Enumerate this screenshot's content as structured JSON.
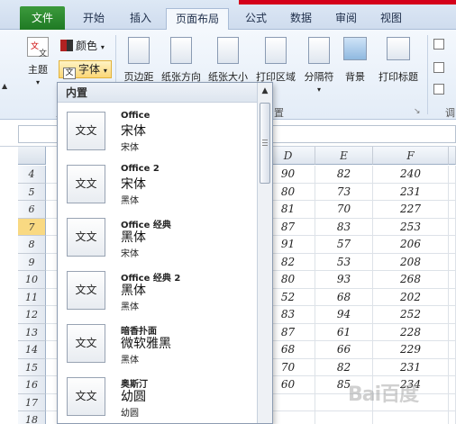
{
  "ribbon_tabs": [
    "文件",
    "开始",
    "插入",
    "页面布局",
    "公式",
    "数据",
    "审阅",
    "视图"
  ],
  "active_tab": "页面布局",
  "ribbon": {
    "theme_label": "主题",
    "colors_label": "颜色",
    "fonts_label": "字体",
    "margins_label": "页边距",
    "orientation_label": "纸张方向",
    "size_label": "纸张大小",
    "print_area_label": "打印区域",
    "breaks_label": "分隔符",
    "background_label": "背景",
    "print_titles_label": "打印标题",
    "page_setup_group": "置",
    "theme_group_fragment": "主",
    "right_fragment": "调",
    "swatch_color": "#b22222"
  },
  "fonts_dropdown": {
    "header": "内置",
    "items": [
      {
        "name": "Office",
        "heading_font": "宋体",
        "body_font": "宋体",
        "preview": "文文"
      },
      {
        "name": "Office 2",
        "heading_font": "宋体",
        "body_font": "黑体",
        "preview": "文文"
      },
      {
        "name": "Office 经典",
        "heading_font": "黑体",
        "body_font": "宋体",
        "preview": "文文"
      },
      {
        "name": "Office 经典 2",
        "heading_font": "黑体",
        "body_font": "黑体",
        "preview": "文文"
      },
      {
        "name": "暗香扑面",
        "heading_font": "微软雅黑",
        "body_font": "黑体",
        "preview": "文文"
      },
      {
        "name": "奥斯汀",
        "heading_font": "幼圆",
        "body_font": "幼圆",
        "preview": "文文"
      }
    ]
  },
  "sheet": {
    "columns": [
      "D",
      "E",
      "F"
    ],
    "rows": [
      {
        "n": "4",
        "d": "90",
        "e": "82",
        "f": "240"
      },
      {
        "n": "5",
        "d": "80",
        "e": "73",
        "f": "231"
      },
      {
        "n": "6",
        "d": "81",
        "e": "70",
        "f": "227"
      },
      {
        "n": "7",
        "d": "87",
        "e": "83",
        "f": "253"
      },
      {
        "n": "8",
        "d": "91",
        "e": "57",
        "f": "206"
      },
      {
        "n": "9",
        "d": "82",
        "e": "53",
        "f": "208"
      },
      {
        "n": "10",
        "d": "80",
        "e": "93",
        "f": "268"
      },
      {
        "n": "11",
        "d": "52",
        "e": "68",
        "f": "202"
      },
      {
        "n": "12",
        "d": "83",
        "e": "94",
        "f": "252"
      },
      {
        "n": "13",
        "d": "87",
        "e": "61",
        "f": "228"
      },
      {
        "n": "14",
        "d": "68",
        "e": "66",
        "f": "229"
      },
      {
        "n": "15",
        "d": "70",
        "e": "82",
        "f": "231"
      },
      {
        "n": "16",
        "d": "60",
        "e": "85",
        "f": "234"
      },
      {
        "n": "17",
        "d": "",
        "e": "",
        "f": ""
      },
      {
        "n": "18",
        "d": "",
        "e": "",
        "f": ""
      }
    ],
    "selected_row": "7"
  }
}
